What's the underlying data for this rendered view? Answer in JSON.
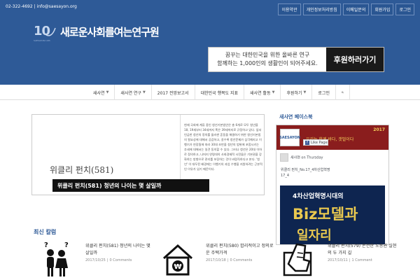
{
  "header": {
    "contact": "02-322-4692  |  info@saesayon.org",
    "top_links": [
      "이용약관",
      "개인정보처리방침",
      "이메일문의",
      "회원가입",
      "로그인"
    ],
    "logo_mark": "10",
    "logo_sub": "SAESAYON 10th",
    "org_name": "새로운사회를여는연구원",
    "banner_line1": "꿈꾸는 대한민국을 위한 올바른 연구",
    "banner_line2": "함께하는 1,000인의 생활인이 되어주세요.",
    "banner_button": "후원하러가기"
  },
  "nav": {
    "items": [
      {
        "label": "새사연",
        "caret": true
      },
      {
        "label": "새사연 연구",
        "caret": true
      },
      {
        "label": "2017 전망보고서",
        "caret": false
      },
      {
        "label": "대한민국 행복도 지표",
        "caret": false
      },
      {
        "label": "새사연 활동",
        "caret": true
      },
      {
        "label": "후원하기",
        "caret": true
      },
      {
        "label": "로그인",
        "caret": false
      }
    ],
    "search_icon": "search-icon"
  },
  "slider": {
    "title": "위클리 펀치(581)",
    "caption": "위클리 펀치(581) 청년의 나이는 몇 살일까",
    "body": "현재 국회에 계류 중인 청년기본법안은 총 6개로 모두 청년을 18, 19세부터 34세까지 혹은 39세까지로 규정하고 있다. 앞서 언급한 청년의 정의를 둘러싼 혼동을 해결하기 위한 청년기본법의 필요성에 대해서 공감하고, 갈수록 청년문제가 심각해지고 이행기가 연장됨에 따라 30대 초반을 청년의 범위에 포함시키는 추세에 대해서는 일견 동의할 수 있다. 그러나 청년은 20대 이하로 정의하고, 나머지 연령대의 사회경제적 시민들은 기본권을 강화하는 방향으로 관리를 보장하는 것이 바람직하다고 본다. '청년' 이 대두된 배경에는 이행기의 과업 수행을 지원하려는 근본적인 이유가 있기 때문이다.",
    "slide_count": 3,
    "active_slide": 1
  },
  "facebook": {
    "title": "새사연 페이스북",
    "cover_year": "2017",
    "cover_slogan": "우리는,함께 바다, 갯벌이다",
    "page_thumb": "SAESAYON",
    "like_label": "Like Page",
    "post_author": "새사연",
    "post_time": "on Thursday",
    "post_text": "위클리 펀치_No.17_4차산업혁명",
    "post_sub": "17_4",
    "image_line1": "4차산업혁명시대의",
    "image_line2": "Biz모델과",
    "image_line3": "일자리"
  },
  "latest": {
    "title": "최신 칼럼",
    "columns": [
      {
        "title": "위클리 펀치(581) 청년의 나이는 몇 살일까",
        "date": "2017/10/25",
        "comments": "0 Comments",
        "icon": "people-question-icon"
      },
      {
        "title": "위클리 펀치(580) 합리적이고 정의로운 주택가격",
        "date": "2017/10/18",
        "comments": "0 Comments",
        "icon": "house-won-icon"
      },
      {
        "title": "위클리 펀치(579) 온전한 노동권 실현의 두 가지 길",
        "date": "2017/10/11",
        "comments": "1 Comment",
        "icon": "fist-box-icon"
      }
    ]
  },
  "colors": {
    "brand_blue": "#2e5a97",
    "dark": "#111111",
    "fb_cover": "#8a1d1d",
    "fb_gold": "#e9c84f"
  }
}
